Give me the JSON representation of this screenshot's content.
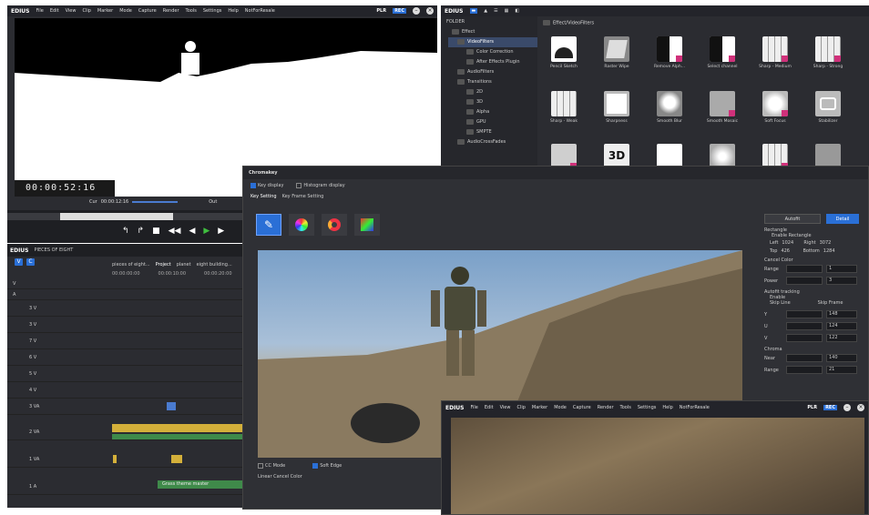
{
  "app": {
    "brand": "EDIUS",
    "menu": [
      "File",
      "Edit",
      "View",
      "Clip",
      "Marker",
      "Mode",
      "Capture",
      "Render",
      "Tools",
      "Settings",
      "Help"
    ],
    "license": "NotForResale",
    "plr": "PLR",
    "rec": "REC"
  },
  "player": {
    "timecode": "00:00:52:16",
    "cur_label": "Cur",
    "cur_value": "00:00:12:16",
    "out_label": "Out"
  },
  "timeline": {
    "brand": "EDIUS",
    "project": "PIECES OF EIGHT",
    "sequence_tabs": [
      "pieces of eight...",
      "Project",
      "planet",
      "eight building..."
    ],
    "ruler": [
      "00:00:00:00",
      "00:00:10:00",
      "00:00:20:00"
    ],
    "tracks": [
      "V",
      "A",
      "3 V",
      "3 V",
      "7 V",
      "6 V",
      "5 V",
      "4 V",
      "3 VA",
      "2 VA",
      "1 VA",
      "1 A"
    ],
    "clip_label": "Grass theme master"
  },
  "bin": {
    "brand": "EDIUS",
    "folder_header": "FOLDER",
    "path": "Effect/VideoFilters",
    "tree": [
      "Effect",
      "VideoFilters",
      "Color Correction",
      "After Effects Plugin",
      "AudioFilters",
      "Transitions",
      "2D",
      "3D",
      "Alpha",
      "GPU",
      "SMPTE",
      "AudioCrossFades"
    ],
    "effects": [
      "Pencil Sketch",
      "Raster Wipe",
      "Remove Alph...",
      "Select channel",
      "Sharp - Medium",
      "Sharp - Strong",
      "Sharp - Weak",
      "Sharpness",
      "Smooth Blur",
      "Smooth Mosaic",
      "Soft Focus",
      "Stabilizer"
    ],
    "row3_badge": "3D"
  },
  "chromakey": {
    "title": "Chromakey",
    "key_display": "Key display",
    "histogram_display": "Histogram display",
    "tabs": [
      "Key Setting",
      "Key Frame Setting"
    ],
    "cc_mode": "CC Mode",
    "soft_edge": "Soft Edge",
    "linear_cancel_color": "Linear Cancel Color",
    "autofit": "Autofit",
    "detail": "Detail",
    "rectangle": "Rectangle",
    "enable_rectangle": "Enable Rectangle",
    "left_label": "Left",
    "left_value": "1024",
    "right_label": "Right",
    "right_value": "3072",
    "top_label": "Top",
    "top_value": "426",
    "bottom_label": "Bottom",
    "bottom_value": "1284",
    "cancel_color": "Cancel Color",
    "range_label": "Range",
    "range_value": "1",
    "power_label": "Power",
    "power_value": "3",
    "autofit_tracking": "Autofit tracking",
    "enable": "Enable",
    "skip_line": "Skip Line",
    "skip_frame": "Skip Frame",
    "y_label": "Y",
    "y_value": "148",
    "u_label": "U",
    "u_value": "124",
    "v_label": "V",
    "v_value": "122",
    "chroma": "Chroma",
    "near_label": "Near",
    "near_value": "140",
    "range2_label": "Range",
    "range2_value": "21"
  },
  "colors": {
    "accent": "#2a6fd6",
    "clip_green": "#3f8a4a",
    "clip_yellow": "#d4b03a",
    "pink": "#d0307a"
  }
}
